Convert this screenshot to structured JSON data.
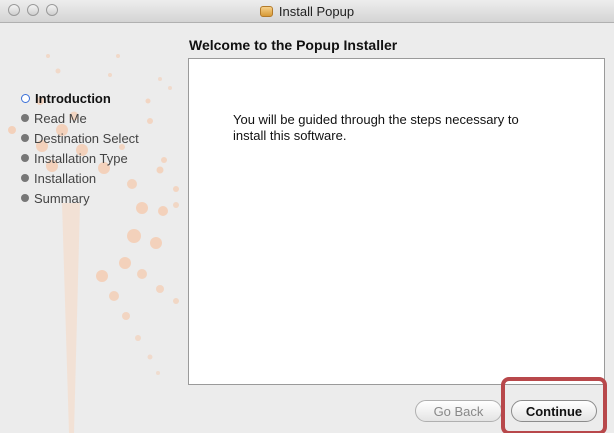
{
  "window": {
    "title": "Install Popup"
  },
  "heading": "Welcome to the Popup Installer",
  "content": {
    "line1": "You will be guided through the steps necessary to",
    "line2": "install this software."
  },
  "steps": [
    {
      "label": "Introduction",
      "state": "current"
    },
    {
      "label": "Read Me",
      "state": "pending"
    },
    {
      "label": "Destination Select",
      "state": "pending"
    },
    {
      "label": "Installation Type",
      "state": "pending"
    },
    {
      "label": "Installation",
      "state": "pending"
    },
    {
      "label": "Summary",
      "state": "pending"
    }
  ],
  "buttons": {
    "back_label": "Go Back",
    "continue_label": "Continue"
  },
  "colors": {
    "highlight": "#b8484b",
    "current_step": "#3a6fd8",
    "decor_dots": "#f6c6a6"
  }
}
